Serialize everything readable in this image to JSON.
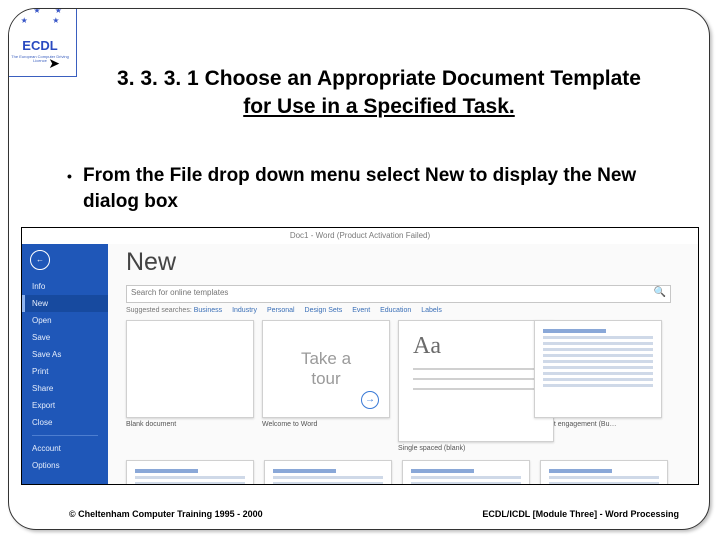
{
  "logo": {
    "brand": "ECDL",
    "subtitle": "The European Computer Driving Licence"
  },
  "title": {
    "line1": "3. 3. 3. 1 Choose an Appropriate Document Template",
    "line2": "for Use in a Specified Task."
  },
  "bullet": {
    "pre": "From the ",
    "kw1": "File",
    "mid": " drop down menu select ",
    "kw2": "New",
    "post": " to display the New dialog box"
  },
  "word": {
    "doc_title": "Doc1 - Word (Product Activation Failed)",
    "heading": "New",
    "search_placeholder": "Search for online templates",
    "suggested_label": "Suggested searches:",
    "suggested": [
      "Business",
      "Industry",
      "Personal",
      "Design Sets",
      "Event",
      "Education",
      "Labels"
    ],
    "sidebar": {
      "items": [
        "Info",
        "New",
        "Open",
        "Save",
        "Save As",
        "Print",
        "Share",
        "Export",
        "Close"
      ],
      "selected_index": 1,
      "footer_items": [
        "Account",
        "Options"
      ]
    },
    "templates": [
      {
        "caption": "Blank document",
        "kind": "blank"
      },
      {
        "caption": "Welcome to Word",
        "kind": "tour",
        "text": "Take a\ntour"
      },
      {
        "caption": "Single spaced (blank)",
        "kind": "spacing"
      },
      {
        "caption": "Project engagement (Bu…",
        "kind": "lines"
      }
    ]
  },
  "footer": {
    "left": "© Cheltenham Computer Training 1995 - 2000",
    "right": "ECDL/ICDL [Module Three]  - Word Processing"
  }
}
